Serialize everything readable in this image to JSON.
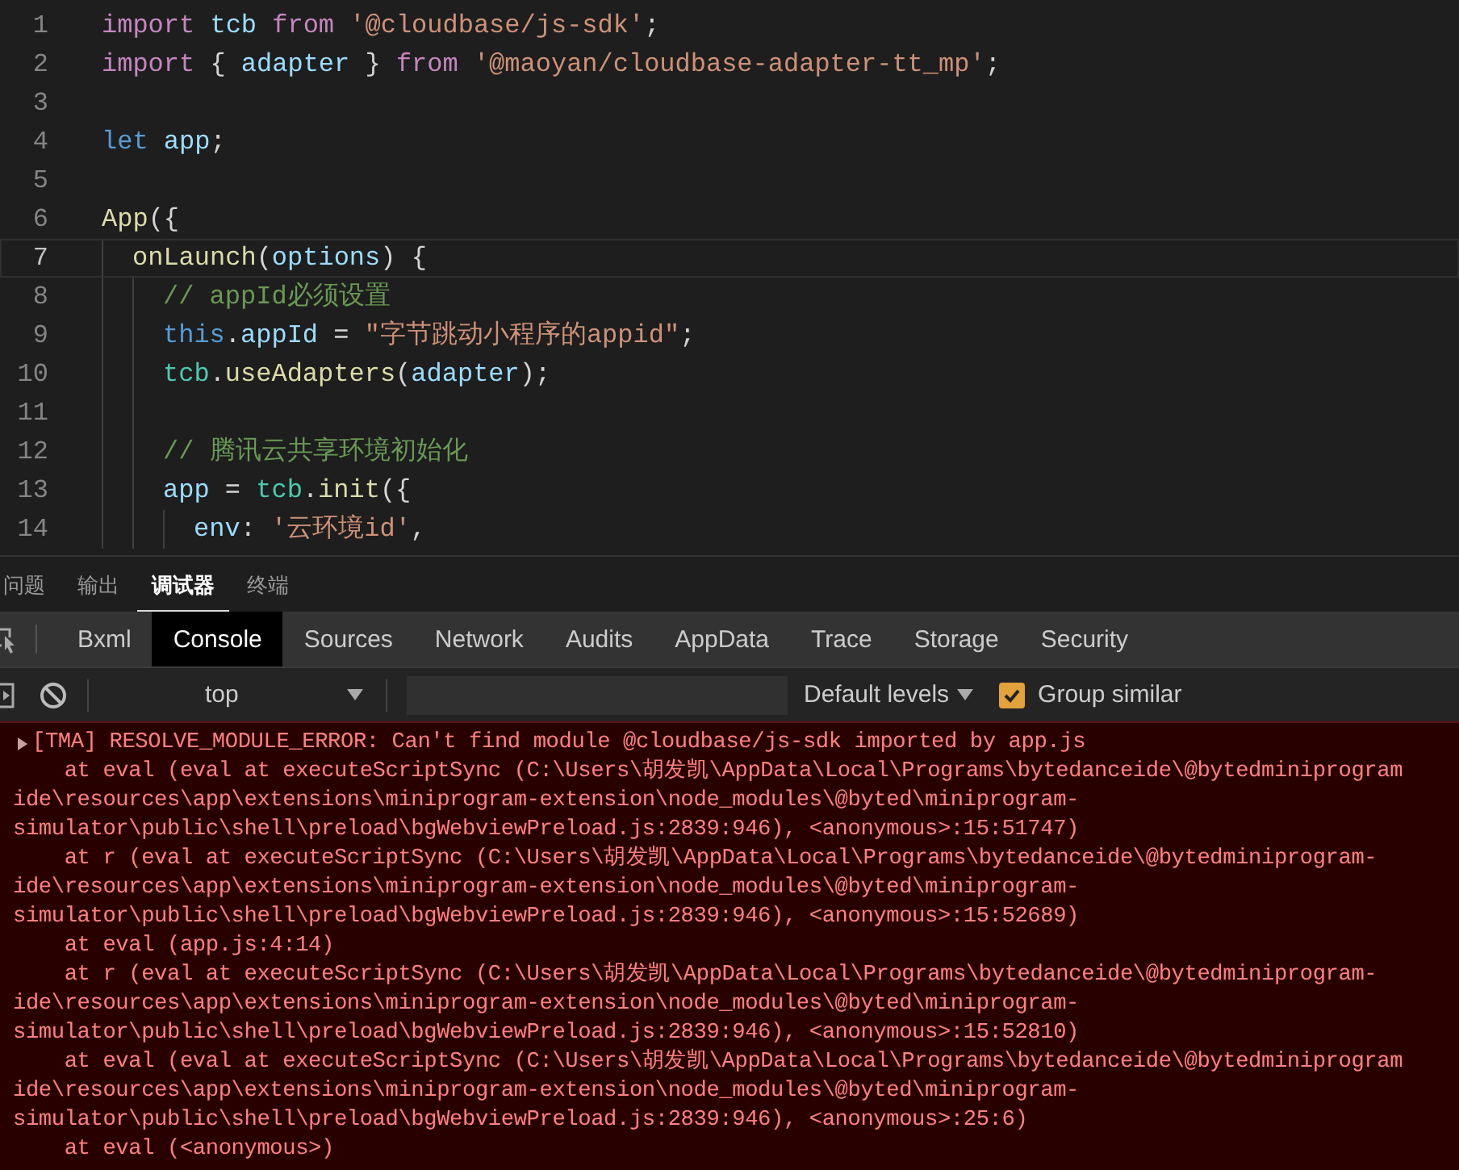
{
  "editor": {
    "lines": [
      {
        "number": "1",
        "current": false,
        "tokens": [
          {
            "kind": "keyword",
            "text": "import "
          },
          {
            "kind": "variable",
            "text": "tcb "
          },
          {
            "kind": "keyword",
            "text": "from "
          },
          {
            "kind": "string",
            "text": "'@cloudbase/js-sdk'"
          },
          {
            "kind": "plain",
            "text": ";"
          }
        ]
      },
      {
        "number": "2",
        "current": false,
        "tokens": [
          {
            "kind": "keyword",
            "text": "import "
          },
          {
            "kind": "plain",
            "text": "{ "
          },
          {
            "kind": "variable",
            "text": "adapter "
          },
          {
            "kind": "plain",
            "text": "} "
          },
          {
            "kind": "keyword",
            "text": "from "
          },
          {
            "kind": "string",
            "text": "'@maoyan/cloudbase-adapter-tt_mp'"
          },
          {
            "kind": "plain",
            "text": ";"
          }
        ]
      },
      {
        "number": "3",
        "current": false
      },
      {
        "number": "4",
        "current": false,
        "tokens": [
          {
            "kind": "storage",
            "text": "let "
          },
          {
            "kind": "variable",
            "text": "app"
          },
          {
            "kind": "plain",
            "text": ";"
          }
        ]
      },
      {
        "number": "5",
        "current": false
      },
      {
        "number": "6",
        "current": false,
        "tokens": [
          {
            "kind": "function",
            "text": "App"
          },
          {
            "kind": "plain",
            "text": "({"
          }
        ],
        "children": [
          {
            "number": "7",
            "current": true,
            "tokens": [
              {
                "kind": "function",
                "text": "onLaunch"
              },
              {
                "kind": "plain",
                "text": "("
              },
              {
                "kind": "variable",
                "text": "options"
              },
              {
                "kind": "plain",
                "text": ") {"
              }
            ],
            "children": [
              {
                "number": "8",
                "current": false,
                "tokens": [
                  {
                    "kind": "comment",
                    "text": "// appId必须设置"
                  }
                ]
              },
              {
                "number": "9",
                "current": false,
                "tokens": [
                  {
                    "kind": "storage",
                    "text": "this"
                  },
                  {
                    "kind": "plain",
                    "text": "."
                  },
                  {
                    "kind": "variable",
                    "text": "appId"
                  },
                  {
                    "kind": "plain",
                    "text": " = "
                  },
                  {
                    "kind": "string",
                    "text": "\"字节跳动小程序的appid\""
                  },
                  {
                    "kind": "plain",
                    "text": ";"
                  }
                ]
              },
              {
                "number": "10",
                "current": false,
                "tokens": [
                  {
                    "kind": "type",
                    "text": "tcb"
                  },
                  {
                    "kind": "plain",
                    "text": "."
                  },
                  {
                    "kind": "function",
                    "text": "useAdapters"
                  },
                  {
                    "kind": "plain",
                    "text": "("
                  },
                  {
                    "kind": "variable",
                    "text": "adapter"
                  },
                  {
                    "kind": "plain",
                    "text": ");"
                  }
                ]
              },
              {
                "number": "11",
                "current": false
              },
              {
                "number": "12",
                "current": false,
                "tokens": [
                  {
                    "kind": "comment",
                    "text": "// 腾讯云共享环境初始化"
                  }
                ]
              },
              {
                "number": "13",
                "current": false,
                "tokens": [
                  {
                    "kind": "variable",
                    "text": "app"
                  },
                  {
                    "kind": "plain",
                    "text": " = "
                  },
                  {
                    "kind": "type",
                    "text": "tcb"
                  },
                  {
                    "kind": "plain",
                    "text": "."
                  },
                  {
                    "kind": "function",
                    "text": "init"
                  },
                  {
                    "kind": "plain",
                    "text": "({"
                  }
                ],
                "children": [
                  {
                    "number": "14",
                    "current": false,
                    "tokens": [
                      {
                        "kind": "variable",
                        "text": "env"
                      },
                      {
                        "kind": "plain",
                        "text": ": "
                      },
                      {
                        "kind": "string",
                        "text": "'云环境id'"
                      },
                      {
                        "kind": "plain",
                        "text": ","
                      }
                    ]
                  }
                ]
              }
            ]
          }
        ]
      }
    ]
  },
  "panel_tabs": [
    {
      "label": "问题",
      "selected": false
    },
    {
      "label": "输出",
      "selected": false
    },
    {
      "label": "调试器",
      "selected": true
    },
    {
      "label": "终端",
      "selected": false
    }
  ],
  "devtools_tabs": [
    {
      "label": "Bxml",
      "selected": false
    },
    {
      "label": "Console",
      "selected": true
    },
    {
      "label": "Sources",
      "selected": false
    },
    {
      "label": "Network",
      "selected": false
    },
    {
      "label": "Audits",
      "selected": false
    },
    {
      "label": "AppData",
      "selected": false
    },
    {
      "label": "Trace",
      "selected": false
    },
    {
      "label": "Storage",
      "selected": false
    },
    {
      "label": "Security",
      "selected": false
    }
  ],
  "console_toolbar": {
    "context": "top",
    "levels": "Default levels",
    "group_similar": {
      "label": "Group similar",
      "checked": true
    }
  },
  "console": {
    "messages": [
      {
        "expanded": false,
        "lines": [
          "[TMA] RESOLVE_MODULE_ERROR: Can't find module @cloudbase/js-sdk imported by app.js",
          "    at eval (eval at executeScriptSync (C:\\Users\\胡发凯\\AppData\\Local\\Programs\\bytedanceide\\@bytedminiprogram",
          "ide\\resources\\app\\extensions\\miniprogram-extension\\node_modules\\@byted\\miniprogram-",
          "simulator\\public\\shell\\preload\\bgWebviewPreload.js:2839:946), <anonymous>:15:51747)",
          "    at r (eval at executeScriptSync (C:\\Users\\胡发凯\\AppData\\Local\\Programs\\bytedanceide\\@bytedminiprogram-",
          "ide\\resources\\app\\extensions\\miniprogram-extension\\node_modules\\@byted\\miniprogram-",
          "simulator\\public\\shell\\preload\\bgWebviewPreload.js:2839:946), <anonymous>:15:52689)",
          "    at eval (app.js:4:14)",
          "    at r (eval at executeScriptSync (C:\\Users\\胡发凯\\AppData\\Local\\Programs\\bytedanceide\\@bytedminiprogram-",
          "ide\\resources\\app\\extensions\\miniprogram-extension\\node_modules\\@byted\\miniprogram-",
          "simulator\\public\\shell\\preload\\bgWebviewPreload.js:2839:946), <anonymous>:15:52810)",
          "    at eval (eval at executeScriptSync (C:\\Users\\胡发凯\\AppData\\Local\\Programs\\bytedanceide\\@bytedminiprogram",
          "ide\\resources\\app\\extensions\\miniprogram-extension\\node_modules\\@byted\\miniprogram-",
          "simulator\\public\\shell\\preload\\bgWebviewPreload.js:2839:946), <anonymous>:25:6)",
          "    at eval (<anonymous>)"
        ]
      }
    ]
  }
}
